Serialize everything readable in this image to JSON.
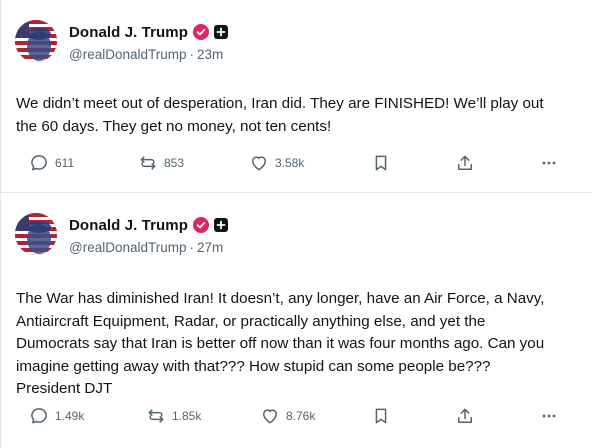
{
  "posts": [
    {
      "display_name": "Donald J. Trump",
      "handle": "@realDonaldTrump",
      "separator": "·",
      "time": "23m",
      "text": "We didn’t meet out of desperation, Iran did. They are FINISHED! We’ll play out\nthe 60 days. They get no money, not ten cents!",
      "replies": "611",
      "reposts": "853",
      "likes": "3.58k"
    },
    {
      "display_name": "Donald J. Trump",
      "handle": "@realDonaldTrump",
      "separator": "·",
      "time": "27m",
      "text": "The War has diminished Iran! It doesn’t, any longer, have an Air Force, a Navy,\nAntiaircraft Equipment, Radar, or practically anything else, and yet the\nDumocrats say that Iran is better off now than it was four months ago. Can you\nimagine getting away with that??? How stupid can some people be???\nPresident DJT",
      "replies": "1.49k",
      "reposts": "1.85k",
      "likes": "8.76k"
    }
  ],
  "icons": {
    "verified": "verified-badge-icon",
    "plus": "plus-badge-icon",
    "reply": "reply-icon",
    "repost": "repost-icon",
    "like": "heart-icon",
    "bookmark": "bookmark-icon",
    "share": "share-icon",
    "more": "more-icon"
  },
  "colors": {
    "verified": "#e0245e",
    "text": "#0f1419",
    "muted": "#536471",
    "divider": "#e6e6e6"
  }
}
